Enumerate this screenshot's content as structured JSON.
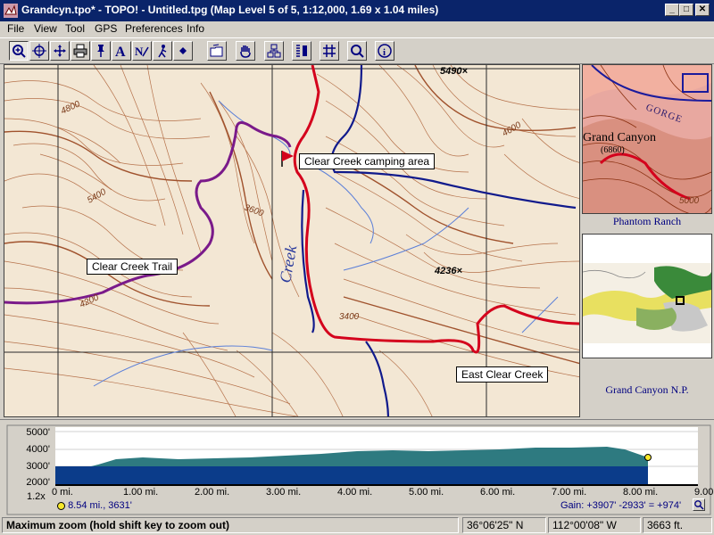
{
  "window": {
    "title": "Grandcyn.tpo* - TOPO! - Untitled.tpg   (Map Level 5 of 5, 1:12,000, 1.69 x 1.04 miles)",
    "controls": [
      "_",
      "□",
      "✕"
    ]
  },
  "menu": [
    "File",
    "View",
    "Tool",
    "GPS",
    "Preferences",
    "Info"
  ],
  "toolbar_icons": [
    "zoom-in-icon",
    "center-icon",
    "pan-icon",
    "print-icon",
    "pin-icon",
    "text-icon",
    "text-edit-icon",
    "trail-icon",
    "waypoint-icon",
    "open-folder-icon",
    "hand-icon",
    "route-icon",
    "profile-icon",
    "grid-icon",
    "search-icon",
    "info-icon"
  ],
  "map": {
    "labels": {
      "camping": "Clear Creek camping area",
      "trail": "Clear Creek Trail",
      "east": "East Clear Creek",
      "creek": "Creek"
    },
    "elevations": {
      "e5490": "5490×",
      "e4236": "4236×",
      "c4800": "4800",
      "c4600": "4600",
      "c5400": "5400",
      "c3600": "3600",
      "c4200": "4200",
      "c3400": "3400"
    },
    "colors": {
      "trail": "#d4001c",
      "route": "#7a1a8a",
      "stream": "#101a8c",
      "contour": "#b5714a",
      "background": "#f3e7d4"
    }
  },
  "insets": {
    "phantom": {
      "caption": "Phantom Ranch",
      "text_gorge": "GORGE",
      "text_gc": "Grand Canyon",
      "text_elev": "(6860)",
      "text_5000": "5000"
    },
    "park": {
      "caption": "Grand Canyon N.P."
    }
  },
  "profile": {
    "zoom": "1.2x",
    "y_labels": [
      "5000'",
      "4000'",
      "3000'",
      "2000'"
    ],
    "x_labels": [
      "0 mi.",
      "1.00 mi.",
      "2.00 mi.",
      "3.00 mi.",
      "4.00 mi.",
      "5.00 mi.",
      "6.00 mi.",
      "7.00 mi.",
      "8.00 mi.",
      "9.00 mi."
    ],
    "cursor_info": "8.54 mi., 3631'",
    "gain": "Gain: +3907' -2933' = +974'"
  },
  "status": {
    "message": "Maximum zoom (hold shift key to zoom out)",
    "lat": "36°06'25\" N",
    "lon": "112°00'08\" W",
    "elev": "3663 ft."
  }
}
